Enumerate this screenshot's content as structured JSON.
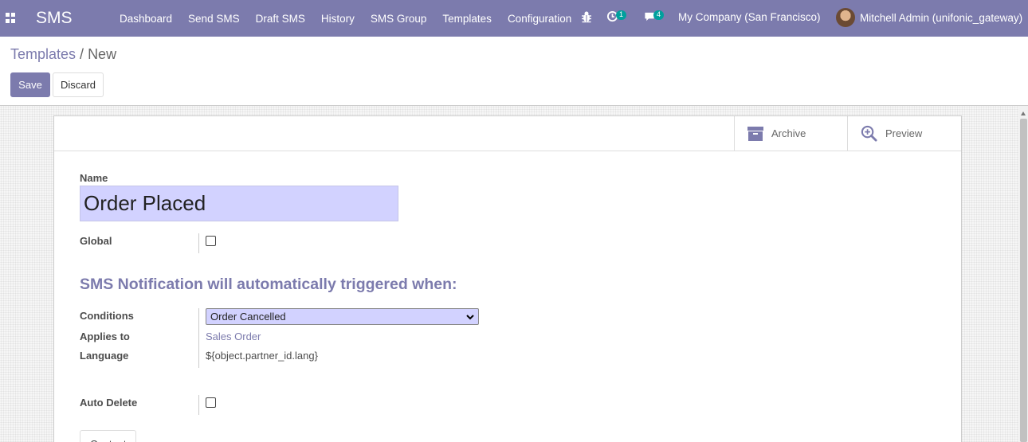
{
  "navbar": {
    "brand": "SMS",
    "menu": [
      "Dashboard",
      "Send SMS",
      "Draft SMS",
      "History",
      "SMS Group",
      "Templates",
      "Configuration"
    ],
    "activity_count": "1",
    "message_count": "4",
    "company": "My Company (San Francisco)",
    "user": "Mitchell Admin (unifonic_gateway)"
  },
  "breadcrumb": {
    "parent": "Templates",
    "separator": "/",
    "current": "New"
  },
  "buttons": {
    "save": "Save",
    "discard": "Discard"
  },
  "stat_buttons": {
    "archive": "Archive",
    "preview": "Preview"
  },
  "form": {
    "name_label": "Name",
    "name_value": "Order Placed",
    "global_label": "Global",
    "section_title": "SMS Notification will automatically triggered when:",
    "conditions_label": "Conditions",
    "conditions_value": "Order Cancelled",
    "applies_label": "Applies to",
    "applies_value": "Sales Order",
    "language_label": "Language",
    "language_value": "${object.partner_id.lang}",
    "auto_delete_label": "Auto Delete",
    "content_tab": "Content"
  },
  "colors": {
    "brand": "#7c7bad",
    "input_highlight": "#d2d2ff",
    "badge": "#00a09d"
  }
}
